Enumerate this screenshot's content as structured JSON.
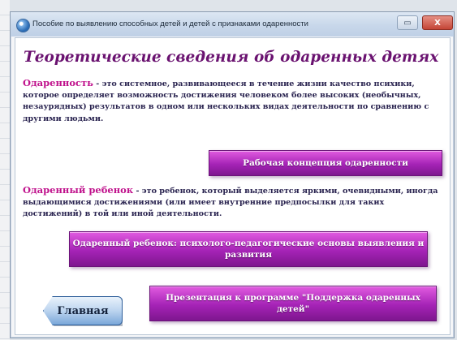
{
  "window": {
    "title": "Пособие по выявлению способных детей и детей с признаками одаренности",
    "min_symbol": "▭",
    "max_symbol": "▭",
    "close_symbol": "X",
    "icon": "globe-icon"
  },
  "content": {
    "heading": "Теоретические сведения об одаренных детях",
    "giftedness": {
      "term": "Одаренность",
      "definition": " - это системное, развивающееся в течение жизни качество психики, которое определяет возможность достижения человеком более высоких (необычных, незаурядных) результатов в одном или нескольких видах деятельности по сравнению с другими людьми."
    },
    "gifted_child": {
      "term": "Одаренный ребенок",
      "definition": " - это ребенок, который выделяется яркими, очевидными, иногда выдающимися достижениями (или имеет внутренние предпосылки для таких достижений) в той или иной деятельности."
    },
    "buttons": {
      "concept": "Рабочая концепция одаренности",
      "basics": "Одаренный ребенок: психолого-педагогические основы выявления и развития",
      "presentation": "Презентация к программе \"Поддержка одаренных детей\"",
      "home": "Главная"
    }
  },
  "colors": {
    "heading": "#6a1270",
    "term": "#c0128c",
    "button_purple": "#a523b6",
    "home_button": "#7aa7d9"
  }
}
